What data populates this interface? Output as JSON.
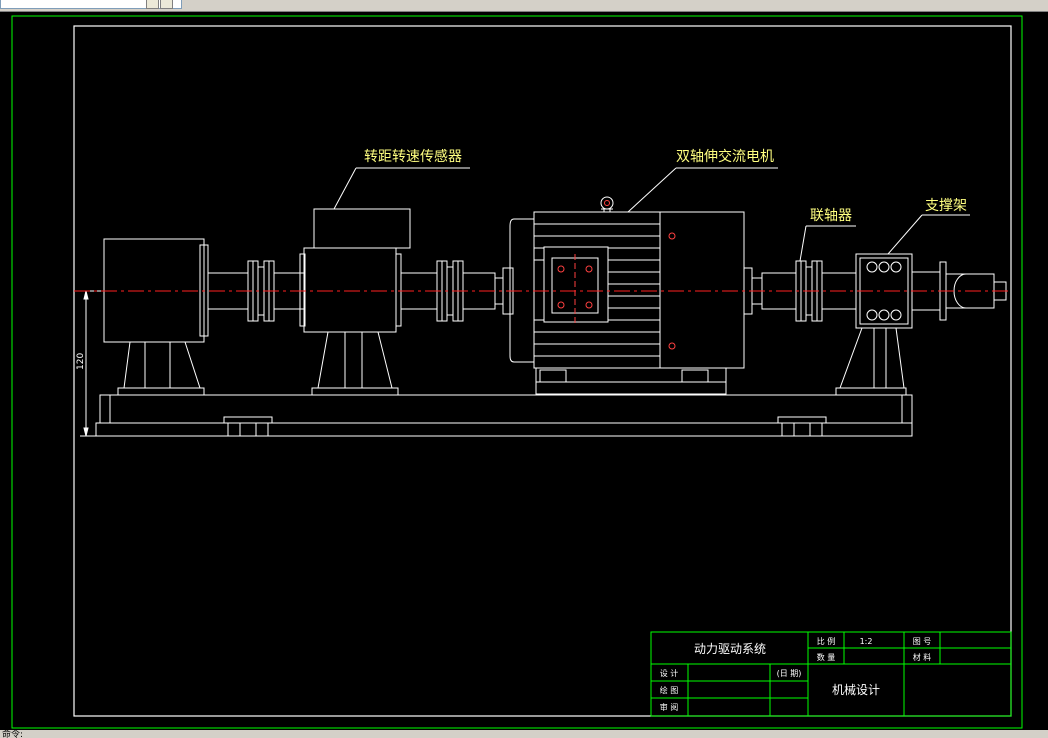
{
  "window": {
    "status_text": "命令:"
  },
  "labels": {
    "sensor": "转距转速传感器",
    "motor": "双轴伸交流电机",
    "coupling": "联轴器",
    "bracket": "支撑架"
  },
  "dimension": {
    "height_value": "120"
  },
  "title_block": {
    "drawing_name": "动力驱动系统",
    "scale_label": "比 例",
    "scale_value": "1:2",
    "drawing_no_label": "图 号",
    "quantity_label": "数 量",
    "material_label": "材 料",
    "design_label": "设 计",
    "date_label": "(日 期)",
    "draw_label": "绘 图",
    "review_label": "审 阅",
    "school": "机械设计"
  },
  "colors": {
    "background": "#000000",
    "frame": "#ffffff",
    "title_block": "#00ff00",
    "label_text": "#ffff80",
    "centerline": "#ff0000",
    "outer_border": "#00ff00"
  }
}
